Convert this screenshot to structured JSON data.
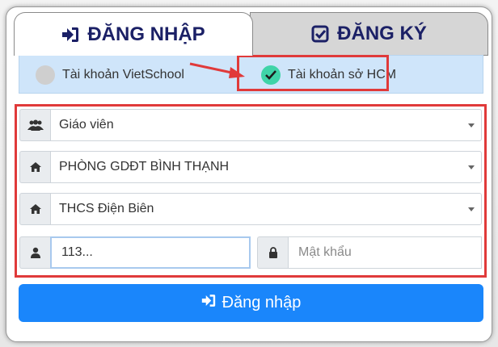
{
  "tabs": {
    "login": "ĐĂNG NHẬP",
    "register": "ĐĂNG KÝ"
  },
  "account_types": [
    {
      "label": "Tài khoản VietSchool",
      "selected": false
    },
    {
      "label": "Tài khoản sở HCM",
      "selected": true
    }
  ],
  "form": {
    "role": "Giáo viên",
    "department": "PHÒNG GDĐT BÌNH THẠNH",
    "school": "THCS Điện Biên",
    "username_value": "113...",
    "password_placeholder": "Mật khẩu"
  },
  "login_button": "Đăng nhập",
  "colors": {
    "tab_text": "#1b2066",
    "highlight": "#e03a3a",
    "account_bar": "#cfe5fa",
    "checked_radio": "#3fd4a8",
    "primary_button": "#1a86fb"
  }
}
